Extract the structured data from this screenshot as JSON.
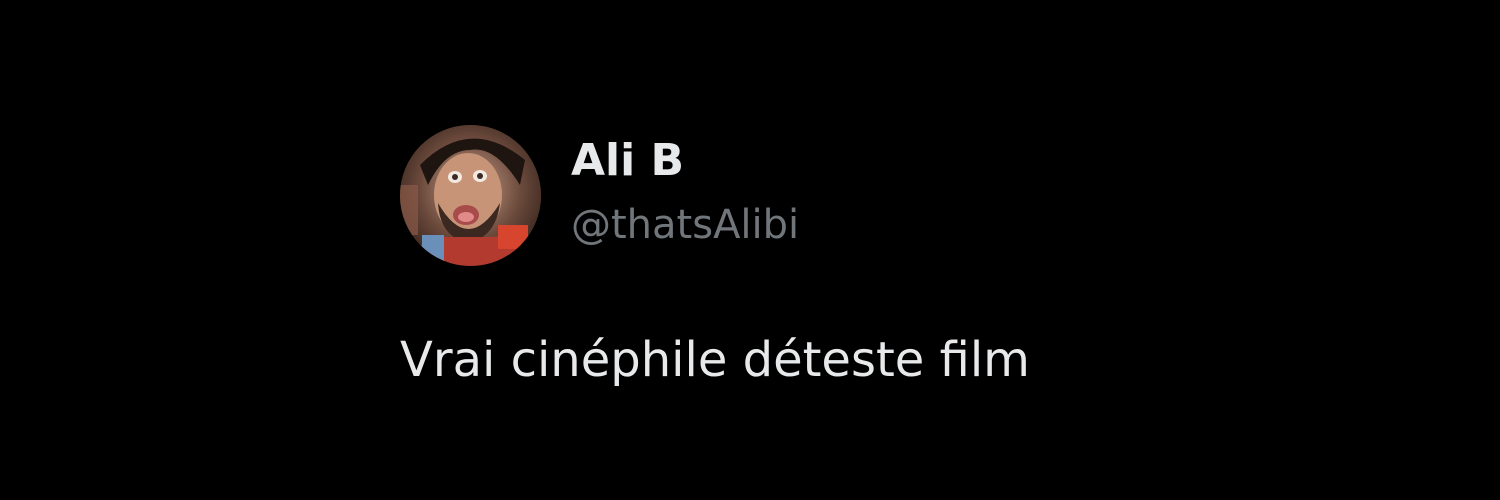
{
  "tweet": {
    "author": {
      "display_name": "Ali B",
      "handle": "@thatsAlibi",
      "avatar_icon": "profile-photo"
    },
    "text": "Vrai cinéphile déteste film"
  },
  "colors": {
    "background": "#000000",
    "primary_text": "#e7e9ea",
    "secondary_text": "#71767b"
  }
}
